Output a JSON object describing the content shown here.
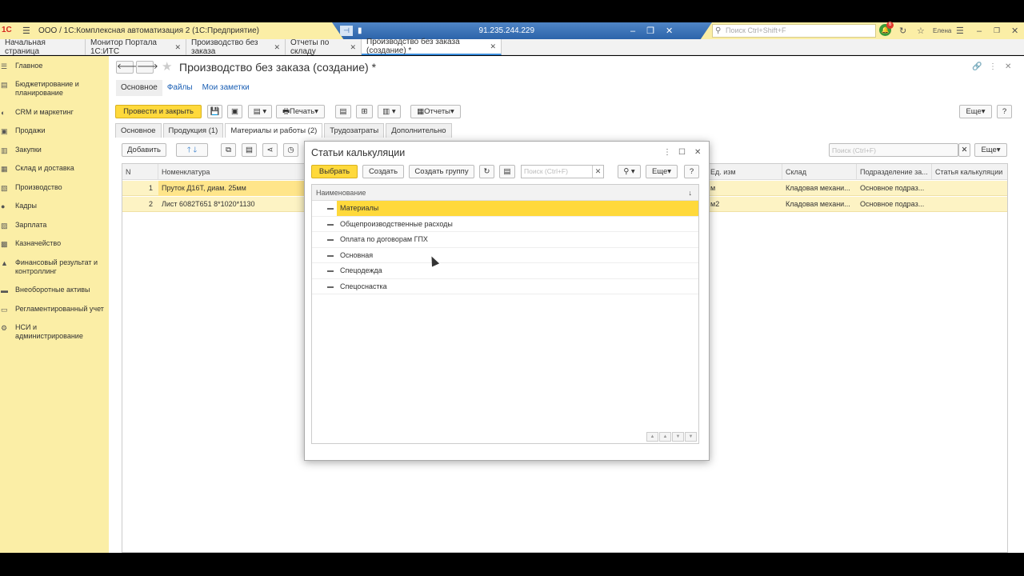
{
  "window": {
    "title": "ООО  /  1С:Комплексная автоматизация 2  (1С:Предприятие)",
    "rdp_ip": "91.235.244.229",
    "search_placeholder": "Поиск Ctrl+Shift+F",
    "user": "Елена",
    "notification_count": "6"
  },
  "tabs": [
    {
      "label": "Начальная страница",
      "closable": false
    },
    {
      "label": "Монитор Портала 1С:ИТС",
      "closable": true
    },
    {
      "label": "Производство без заказа",
      "closable": true
    },
    {
      "label": "Отчеты по складу",
      "closable": true
    },
    {
      "label": "Производство без заказа (создание) *",
      "closable": true,
      "active": true
    }
  ],
  "sidebar": {
    "items": [
      {
        "label": "Главное"
      },
      {
        "label": "Бюджетирование и\nпланирование"
      },
      {
        "label": "CRM и маркетинг"
      },
      {
        "label": "Продажи"
      },
      {
        "label": "Закупки"
      },
      {
        "label": "Склад и доставка"
      },
      {
        "label": "Производство"
      },
      {
        "label": "Кадры"
      },
      {
        "label": "Зарплата"
      },
      {
        "label": "Казначейство"
      },
      {
        "label": "Финансовый результат и\nконтроллинг"
      },
      {
        "label": "Внеоборотные активы"
      },
      {
        "label": "Регламентированный учет"
      },
      {
        "label": "НСИ и\nадминистрирование"
      }
    ]
  },
  "document": {
    "title": "Производство без заказа (создание) *",
    "subnav": [
      "Основное",
      "Файлы",
      "Мои заметки"
    ],
    "post_close_label": "Провести и закрыть",
    "print_label": "Печать",
    "reports_label": "Отчеты",
    "more_label": "Еще",
    "help_label": "?",
    "form_tabs": [
      "Основное",
      "Продукция (1)",
      "Материалы и работы (2)",
      "Трудозатраты",
      "Дополнительно"
    ],
    "add_label": "Добавить",
    "search_placeholder": "Поиск (Ctrl+F)",
    "grid_more_label": "Еще",
    "columns": [
      "N",
      "Номенклатура",
      "Ед. изм",
      "Склад",
      "Подразделение за...",
      "Статья калькуляции"
    ],
    "rows": [
      {
        "n": "1",
        "item": "Пруток Д16Т, диам. 25мм",
        "unit": "м",
        "warehouse": "Кладовая механи...",
        "dept": "Основное подраз..."
      },
      {
        "n": "2",
        "item": "Лист 6082Т651 8*1020*1130",
        "unit": "м2",
        "warehouse": "Кладовая механи...",
        "dept": "Основное подраз..."
      }
    ]
  },
  "dialog": {
    "title": "Статьи калькуляции",
    "select_label": "Выбрать",
    "create_label": "Создать",
    "create_group_label": "Создать группу",
    "search_placeholder": "Поиск (Ctrl+F)",
    "more_label": "Еще",
    "help_label": "?",
    "column": "Наименование",
    "items": [
      "Материалы",
      "Общепроизводственные расходы",
      "Оплата по договорам ГПХ",
      "Основная",
      "Спецодежда",
      "Спецоснастка"
    ]
  },
  "colors": {
    "sidebar_bg": "#fbeea6",
    "accent_yellow": "#ffd93b",
    "rdp_blue": "#2c64aa",
    "active_tab_underline": "#3a8ddc"
  }
}
